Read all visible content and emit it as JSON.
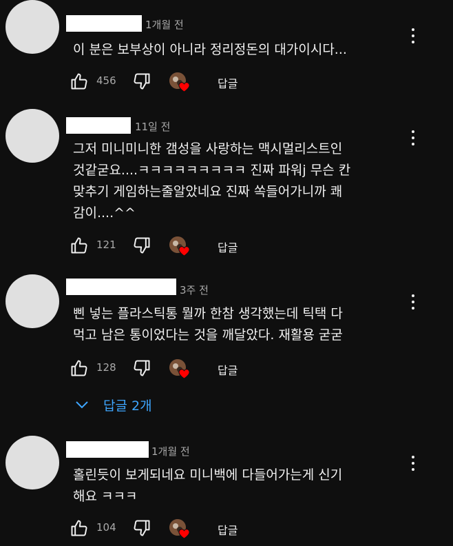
{
  "comments": [
    {
      "time": "1개월 전",
      "text": "이 분은 보부상이 아니라 정리정돈의 대가이시다...",
      "likes": "456",
      "reply_label": "답글"
    },
    {
      "time": "11일 전",
      "text": "그저 미니미니한 갬성을 사랑하는 맥시멀리스트인\n것같굳요....ㅋㅋㅋㅋㅋㅋㅋㅋㅋ 진짜 파워j 무슨 칸\n맞추기 게임하는줄알았네요 진짜 쏙들어가니까 쾌\n감이....^^",
      "likes": "121",
      "reply_label": "답글"
    },
    {
      "time": "3주 전",
      "text": "삔 넣는 플라스틱통 뭘까 한참 생각했는데 틱택 다\n먹고 남은 통이었다는 것을 깨달았다. 재활용 굳굳",
      "likes": "128",
      "reply_label": "답글",
      "replies_label": "답글 2개"
    },
    {
      "time": "1개월 전",
      "text": "홀린듯이 보게되네요 미니백에 다들어가는게 신기\n해요 ㅋㅋㅋ",
      "likes": "104",
      "reply_label": "답글"
    }
  ],
  "icons": {
    "like": "thumbs-up-icon",
    "dislike": "thumbs-down-icon",
    "more": "more-vert-icon",
    "heart": "creator-heart-icon",
    "chevron": "chevron-down-icon"
  },
  "colors": {
    "background": "#0f0f0f",
    "text": "#f1f1f1",
    "secondary_text": "#aaaaaa",
    "link": "#3ea6ff",
    "heart": "#ff0000"
  }
}
